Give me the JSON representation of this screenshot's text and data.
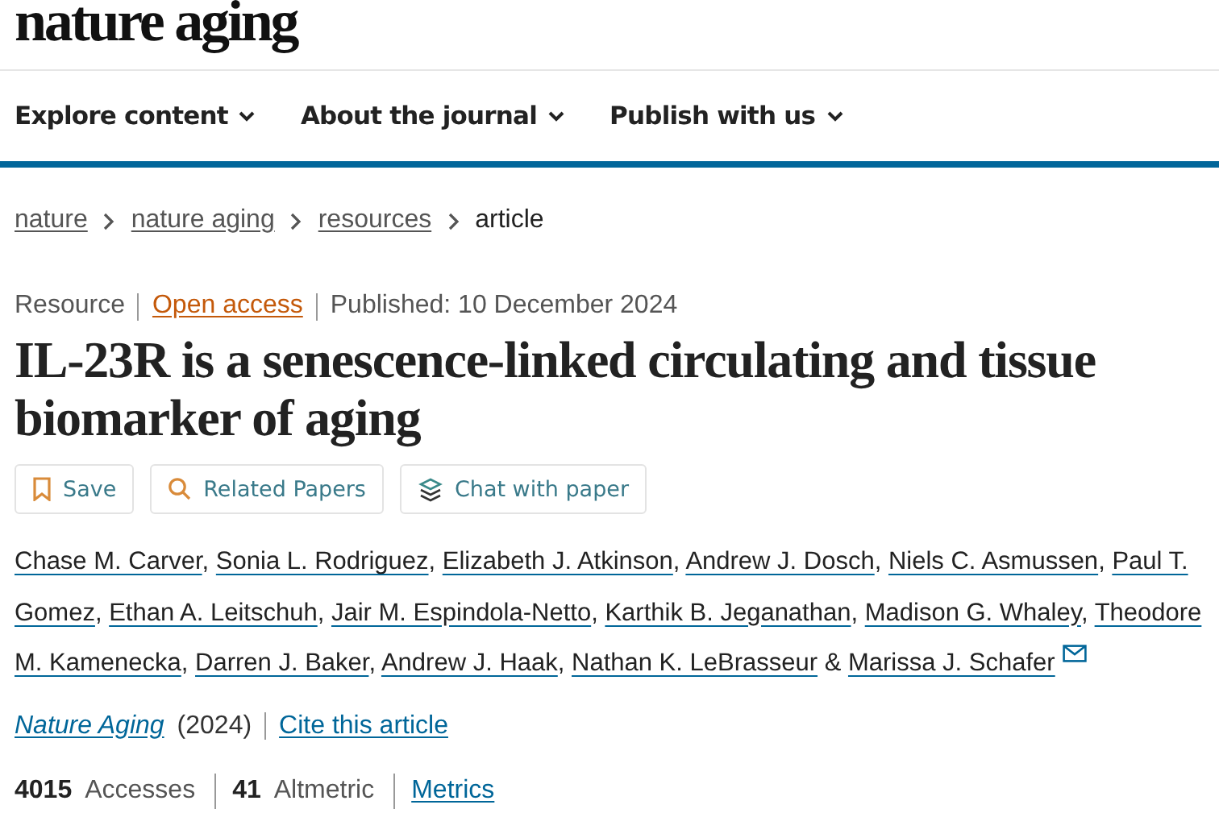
{
  "logo": "nature aging",
  "nav": [
    {
      "label": "Explore content"
    },
    {
      "label": "About the journal"
    },
    {
      "label": "Publish with us"
    }
  ],
  "breadcrumb": [
    {
      "label": "nature",
      "link": true
    },
    {
      "label": "nature aging",
      "link": true
    },
    {
      "label": "resources",
      "link": true
    },
    {
      "label": "article",
      "link": false
    }
  ],
  "meta": {
    "type": "Resource",
    "access": "Open access",
    "published": "Published: 10 December 2024"
  },
  "title": "IL-23R is a senescence-linked circulating and tissue biomarker of aging",
  "actions": [
    {
      "kind": "save",
      "label": "Save"
    },
    {
      "kind": "related",
      "label": "Related Papers"
    },
    {
      "kind": "chat",
      "label": "Chat with paper"
    }
  ],
  "authors": [
    {
      "name": "Chase M. Carver",
      "separator": ","
    },
    {
      "name": "Sonia L. Rodriguez",
      "separator": ","
    },
    {
      "name": "Elizabeth J. Atkinson",
      "separator": ","
    },
    {
      "name": "Andrew J. Dosch",
      "separator": ","
    },
    {
      "name": "Niels C. Asmussen",
      "separator": ","
    },
    {
      "name": "Paul T. Gomez",
      "separator": ","
    },
    {
      "name": "Ethan A. Leitschuh",
      "separator": ","
    },
    {
      "name": "Jair M. Espindola-Netto",
      "separator": ","
    },
    {
      "name": "Karthik B. Jeganathan",
      "separator": ","
    },
    {
      "name": "Madison G. Whaley",
      "separator": ","
    },
    {
      "name": "Theodore M. Kamenecka",
      "separator": ","
    },
    {
      "name": "Darren J. Baker",
      "separator": ","
    },
    {
      "name": "Andrew J. Haak",
      "separator": ","
    },
    {
      "name": "Nathan K. LeBrasseur",
      "separator": "&"
    },
    {
      "name": "Marissa J. Schafer",
      "email": true
    }
  ],
  "citation": {
    "journal": "Nature Aging",
    "year": "(2024)",
    "cite": "Cite this article"
  },
  "metrics": {
    "accesses_count": "4015",
    "accesses_label": "Accesses",
    "altmetric_count": "41",
    "altmetric_label": "Altmetric",
    "link": "Metrics"
  }
}
